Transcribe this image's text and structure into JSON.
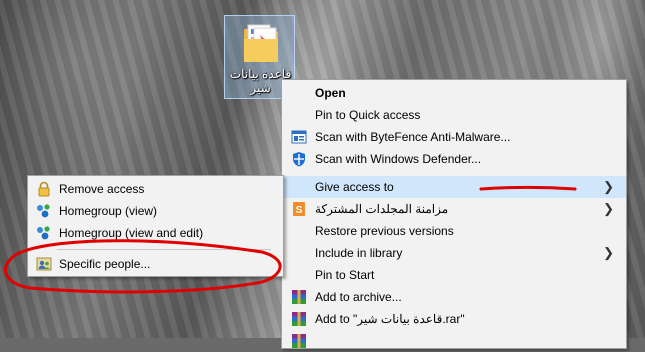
{
  "desktop": {
    "folder": {
      "name": "قاعدة بيانات شير"
    }
  },
  "context_menu": {
    "items": [
      {
        "label": "Open",
        "bold": true,
        "icon": ""
      },
      {
        "label": "Pin to Quick access",
        "icon": ""
      },
      {
        "label": "Scan with ByteFence Anti-Malware...",
        "icon": "bytefence-icon"
      },
      {
        "label": "Scan with Windows Defender...",
        "icon": "windows-defender-icon"
      },
      {
        "label": "Give access to",
        "icon": "",
        "submenu": true,
        "highlighted": true
      },
      {
        "label": "مزامنة المجلدات المشتركة",
        "icon": "sync-icon",
        "submenu": true
      },
      {
        "label": "Restore previous versions",
        "icon": ""
      },
      {
        "label": "Include in library",
        "icon": "",
        "submenu": true
      },
      {
        "label": "Pin to Start",
        "icon": ""
      },
      {
        "label": "Add to archive...",
        "icon": "winrar-icon"
      },
      {
        "label": "Add to \"قاعدة بيانات شير.rar\"",
        "icon": "winrar-icon"
      }
    ]
  },
  "give_access_submenu": {
    "items": [
      {
        "label": "Remove access",
        "icon": "lock-icon"
      },
      {
        "label": "Homegroup (view)",
        "icon": "homegroup-icon"
      },
      {
        "label": "Homegroup (view and edit)",
        "icon": "homegroup-icon"
      },
      {
        "label": "Specific people...",
        "icon": "people-icon"
      }
    ]
  },
  "colors": {
    "menu_bg": "#f2f2f2",
    "highlight": "#cfe6fb",
    "annotation_red": "#e00000"
  }
}
